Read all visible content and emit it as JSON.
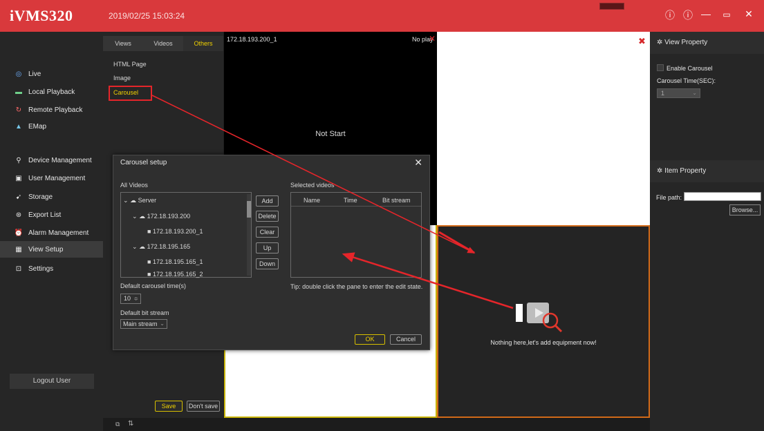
{
  "app": {
    "title": "iVMS320",
    "datetime": "2019/02/25 15:03:24",
    "window_buttons": [
      "⓪",
      "⓪",
      "—",
      "□",
      "✕"
    ]
  },
  "nav": {
    "items": [
      {
        "label": "Live",
        "icon": "live-icon",
        "glyph": "◎",
        "color": "#6fb0ff"
      },
      {
        "label": "Local Playback",
        "icon": "local-playback-icon",
        "glyph": "▬",
        "color": "#6fcf8a"
      },
      {
        "label": "Remote Playback",
        "icon": "remote-playback-icon",
        "glyph": "↻",
        "color": "#ff6a6a"
      },
      {
        "label": "EMap",
        "icon": "emap-icon",
        "glyph": "▲",
        "color": "#76c6e8"
      },
      {
        "label": "Device Management",
        "icon": "device-management-icon",
        "glyph": "⚲",
        "color": "#e6e6e6"
      },
      {
        "label": "User Management",
        "icon": "user-management-icon",
        "glyph": "▣",
        "color": "#e6e6e6"
      },
      {
        "label": "Storage",
        "icon": "storage-icon",
        "glyph": "➹",
        "color": "#e6e6e6"
      },
      {
        "label": "Export List",
        "icon": "export-list-icon",
        "glyph": "⊛",
        "color": "#e6e6e6"
      },
      {
        "label": "Alarm Management",
        "icon": "alarm-icon",
        "glyph": "⏰",
        "color": "#ff6a6a"
      },
      {
        "label": "View Setup",
        "icon": "view-setup-icon",
        "glyph": "▦",
        "color": "#e6e6e6"
      },
      {
        "label": "Settings",
        "icon": "settings-icon",
        "glyph": "⊡",
        "color": "#e6e6e6"
      }
    ],
    "active": "View Setup",
    "logout": "Logout User"
  },
  "others": {
    "tabs": [
      "Views",
      "Videos",
      "Others"
    ],
    "active_tab": "Others",
    "pages": [
      "HTML Page",
      "Image",
      "Carousel"
    ],
    "save": "Save",
    "dont_save": "Don't save",
    "accent": "#f0d100"
  },
  "panes": {
    "pane1_title": "172.18.193.200_1",
    "pane1_status": "No play",
    "pane1_center": "Not Start",
    "empty_message": "Nothing here,let's add equipment now!"
  },
  "right": {
    "view_property": "View Property",
    "enable_carousel": "Enable Carousel",
    "carousel_time_label": "Carousel Time(SEC):",
    "carousel_time_value": "1",
    "item_property": "Item Property",
    "file_path_label": "File path:",
    "browse": "Browse..."
  },
  "dialog": {
    "title": "Carousel setup",
    "all_videos": "All Videos",
    "selected_videos": "Selected videos",
    "tree": [
      "Server",
      "172.18.193.200",
      "172.18.193.200_1",
      "172.18.195.165",
      "172.18.195.165_1",
      "172.18.195.165_2"
    ],
    "buttons": [
      "Add",
      "Delete",
      "Clear",
      "Up",
      "Down"
    ],
    "columns": [
      "Name",
      "Time",
      "Bit stream"
    ],
    "tip": "Tip: double click the pane to enter the edit state.",
    "default_time_label": "Default carousel time(s)",
    "default_time_value": "10",
    "default_bitstream_label": "Default bit stream",
    "default_bitstream_value": "Main stream",
    "ok": "OK",
    "cancel": "Cancel"
  },
  "colors": {
    "titlebar": "#d9393c",
    "highlight": "#e5252a",
    "pane_border_active": "#d26a18"
  }
}
